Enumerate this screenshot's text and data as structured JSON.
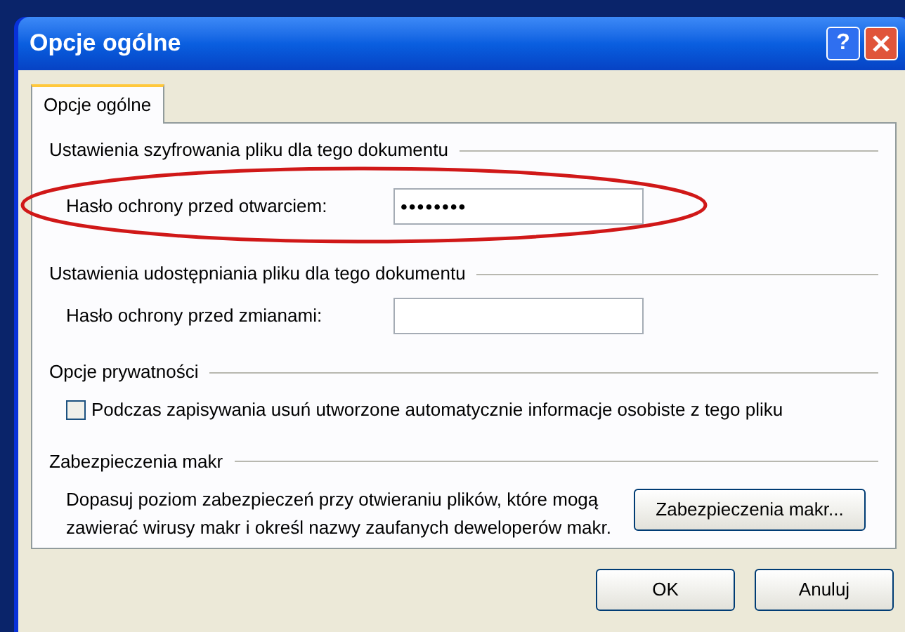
{
  "window": {
    "title": "Opcje ogólne",
    "help_button": "?"
  },
  "tabs": [
    {
      "label": "Opcje ogólne",
      "selected": true
    }
  ],
  "encryption": {
    "heading": "Ustawienia szyfrowania pliku dla tego dokumentu",
    "label": "Hasło ochrony przed otwarciem:",
    "value": "••••••••"
  },
  "sharing": {
    "heading": "Ustawienia udostępniania pliku dla tego dokumentu",
    "label": "Hasło ochrony przed zmianami:"
  },
  "privacy": {
    "heading": "Opcje prywatności",
    "checkbox": {
      "label": "Podczas zapisywania usuń utworzone automatycznie informacje osobiste z tego pliku",
      "checked": false
    }
  },
  "macros": {
    "heading": "Zabezpieczenia makr",
    "description": "Dopasuj poziom zabezpieczeń przy otwieraniu plików, które mogą zawierać wirusy makr i określ nazwy zaufanych deweloperów makr.",
    "button": "Zabezpieczenia makr..."
  },
  "buttons": [
    "OK",
    "Anuluj"
  ]
}
